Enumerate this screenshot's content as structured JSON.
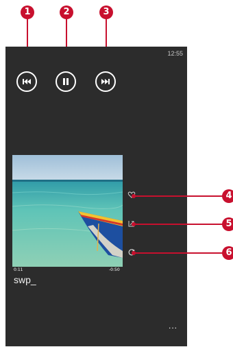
{
  "status_bar": {
    "time": "12:55"
  },
  "callouts": [
    "1",
    "2",
    "3",
    "4",
    "5",
    "6"
  ],
  "player": {
    "elapsed": "0:11",
    "remaining": "-0:50",
    "track_title": "swp_",
    "more_label": "..."
  },
  "icons": {
    "previous": "previous-track-icon",
    "pause": "pause-icon",
    "next": "next-track-icon",
    "favorite": "heart-icon",
    "share": "share-icon",
    "repeat": "repeat-icon"
  },
  "colors": {
    "callout": "#c8102e",
    "screen_bg": "#2c2c2c"
  }
}
